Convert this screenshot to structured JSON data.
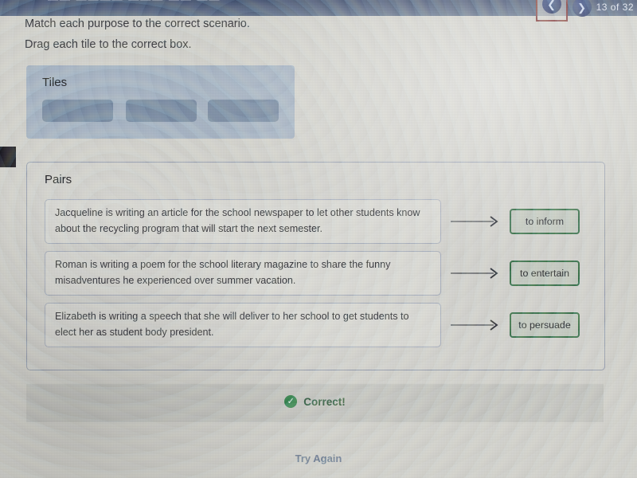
{
  "topbar": {
    "ghost_text": "——  ————  ———   ——    ——",
    "pager_label": "13 of 32",
    "prev_icon": "chevron-left-icon",
    "next_icon": "chevron-right-icon"
  },
  "prompt": {
    "line1": "Match each purpose to the correct scenario.",
    "line2": "Drag each tile to the correct box."
  },
  "tiles": {
    "title": "Tiles",
    "slots": [
      "",
      "",
      ""
    ]
  },
  "pairs": {
    "title": "Pairs",
    "rows": [
      {
        "scenario": "Jacqueline is writing an article for the school newspaper to let other students know about the recycling program that will start the next semester.",
        "arrow_icon": "arrow-right-icon",
        "answer": "to inform"
      },
      {
        "scenario": "Roman is writing a poem for the school literary magazine to share the funny misadventures he experienced over summer vacation.",
        "arrow_icon": "arrow-right-icon",
        "answer": "to entertain"
      },
      {
        "scenario": "Elizabeth is writing a speech that she will deliver to her school to get students to elect her as student body president.",
        "arrow_icon": "arrow-right-icon",
        "answer": "to persuade"
      }
    ]
  },
  "feedback": {
    "icon": "check-circle-icon",
    "text": "Correct!",
    "color": "#2e8049"
  },
  "footer": {
    "try_again_label": "Try Again"
  },
  "colors": {
    "topbar": "#455674",
    "accent_green": "#2f6b42",
    "focus_outline": "#7d3230",
    "tile_panel": "#839bba"
  }
}
